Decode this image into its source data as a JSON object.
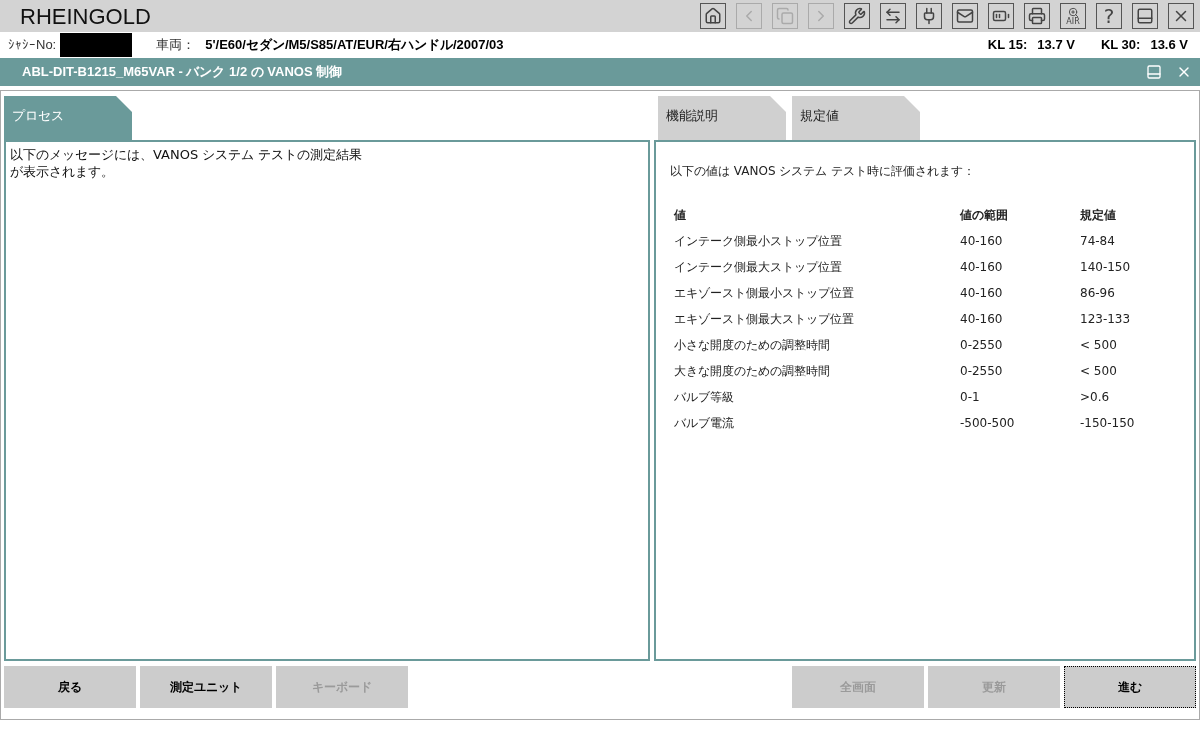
{
  "app": {
    "title": "RHEINGOLD"
  },
  "toolbar": [
    {
      "kind": "home",
      "disabled": false
    },
    {
      "kind": "back",
      "disabled": true
    },
    {
      "kind": "copy",
      "disabled": true
    },
    {
      "kind": "forward",
      "disabled": true
    },
    {
      "kind": "wrench",
      "disabled": false
    },
    {
      "kind": "swap",
      "disabled": false
    },
    {
      "kind": "plug",
      "disabled": false
    },
    {
      "kind": "mail",
      "disabled": false
    },
    {
      "kind": "battery",
      "disabled": false
    },
    {
      "kind": "printer",
      "disabled": false
    },
    {
      "kind": "air",
      "label": "AIR",
      "disabled": false
    },
    {
      "kind": "help",
      "label": "?",
      "disabled": false
    },
    {
      "kind": "menu",
      "disabled": false
    },
    {
      "kind": "close",
      "disabled": false
    }
  ],
  "vehicle": {
    "chassis_label": "ｼｬｼｰNo:",
    "vehicle_label": "車両：",
    "vehicle_value": "5'/E60/セダン/M5/S85/AT/EUR/右ハンドル/2007/03",
    "kl15_label": "KL 15:",
    "kl15_value": "13.7 V",
    "kl30_label": "KL 30:",
    "kl30_value": "13.6 V"
  },
  "window": {
    "title": "ABL-DIT-B1215_M65VAR - バンク 1/2 の VANOS 制御"
  },
  "left_tabs": [
    {
      "label": "プロセス",
      "selected": true
    }
  ],
  "left_text": [
    "以下のメッセージには、VANOS システム テストの測定結果",
    "が表示されます。"
  ],
  "right_tabs": [
    {
      "label": "機能説明",
      "selected": false
    },
    {
      "label": "規定値",
      "selected": false
    }
  ],
  "right_intro": "以下の値は VANOS システム テスト時に評価されます：",
  "table": {
    "columns": [
      "値",
      "値の範囲",
      "規定値"
    ],
    "rows": [
      [
        "インテーク側最小ストップ位置",
        "40-160",
        "74-84"
      ],
      [
        "インテーク側最大ストップ位置",
        "40-160",
        "140-150"
      ],
      [
        "エキゾースト側最小ストップ位置",
        "40-160",
        "86-96"
      ],
      [
        "エキゾースト側最大ストップ位置",
        "40-160",
        "123-133"
      ],
      [
        "小さな開度のための調整時間",
        "0-2550",
        "< 500"
      ],
      [
        "大きな開度のための調整時間",
        "0-2550",
        "< 500"
      ],
      [
        "バルブ等級",
        "0-1",
        ">0.6"
      ],
      [
        "バルブ電流",
        "-500-500",
        "-150-150"
      ]
    ]
  },
  "left_buttons": [
    {
      "label": "戻る",
      "disabled": false,
      "focused": false
    },
    {
      "label": "測定ユニット",
      "disabled": false,
      "focused": false
    },
    {
      "label": "キーボード",
      "disabled": true,
      "focused": false
    }
  ],
  "right_buttons": [
    {
      "label": "全画面",
      "disabled": true,
      "focused": false
    },
    {
      "label": "更新",
      "disabled": true,
      "focused": false
    },
    {
      "label": "進む",
      "disabled": false,
      "focused": true
    }
  ]
}
